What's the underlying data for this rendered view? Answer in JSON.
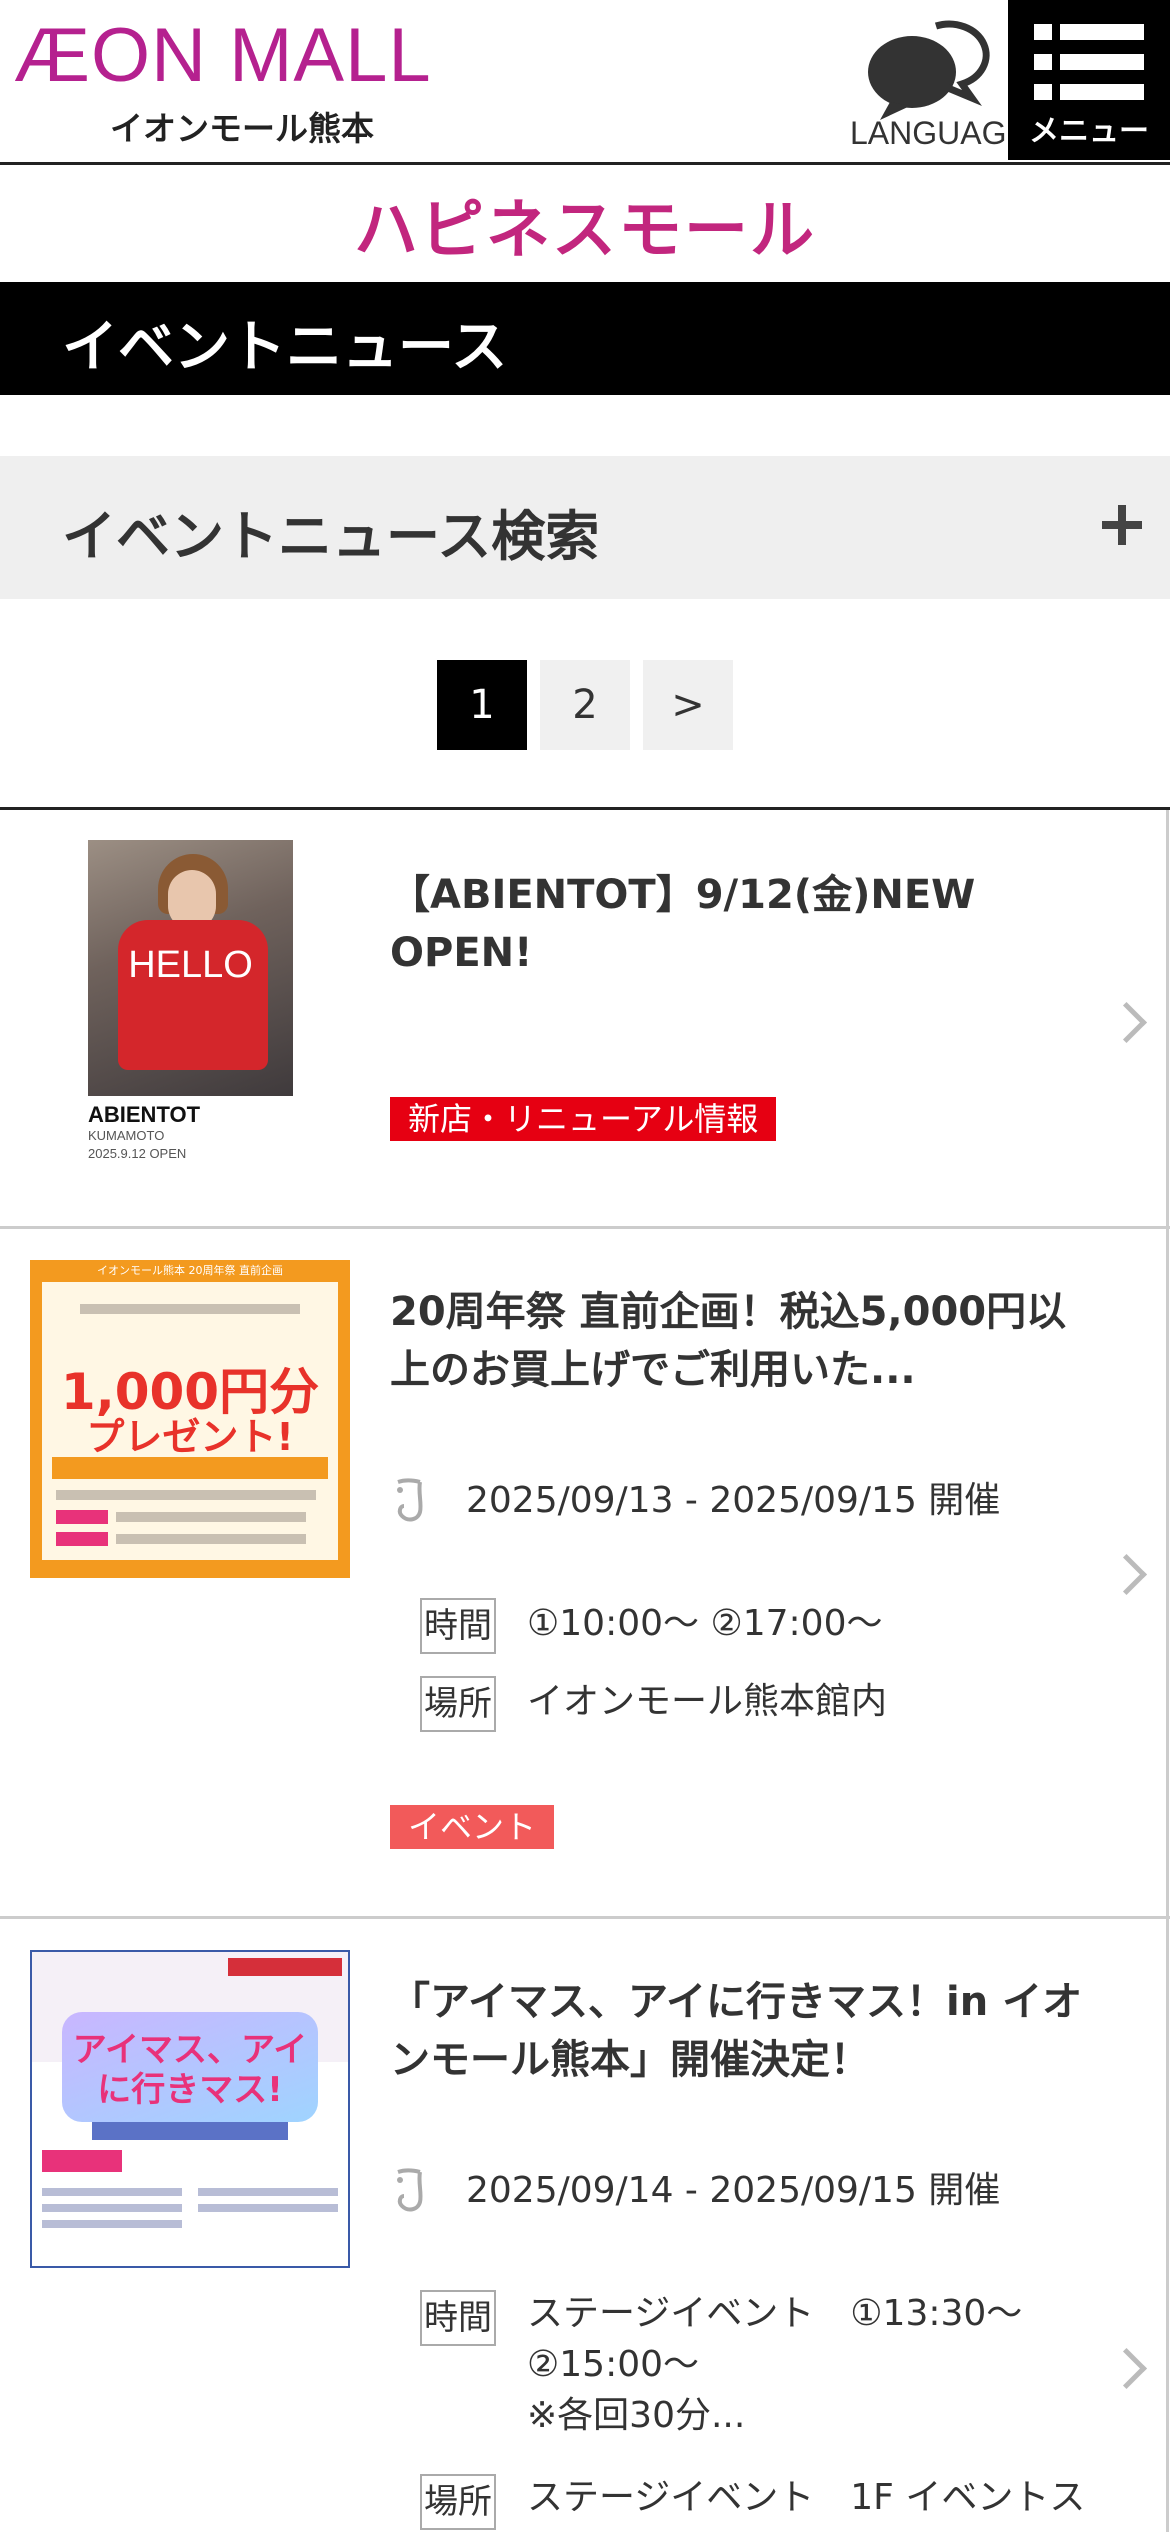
{
  "header": {
    "logo_main": "ÆON MALL",
    "logo_sub": "イオンモール熊本",
    "language_label": "LANGUAGE",
    "menu_label": "メニュー"
  },
  "brand": {
    "text": "ハピネスモール"
  },
  "page_title": "イベントニュース",
  "search": {
    "title": "イベントニュース検索"
  },
  "pagination": {
    "pages": [
      "1",
      "2"
    ],
    "next": ">",
    "current": "1"
  },
  "items": [
    {
      "title": "【ABIENTOT】9/12(金)NEW OPEN!",
      "thumb": {
        "hello": "HELLO",
        "brand": "ABIENTOT",
        "city": "KUMAMOTO",
        "date": "2025.9.12 OPEN"
      },
      "category": "新店・リニューアル情報",
      "category_color": "#e60012"
    },
    {
      "title": "20周年祭 直前企画！税込5,000円以上のお買上げでご利用いた...",
      "thumb": {
        "big": "1,000円分",
        "present": "プレゼント!",
        "header": "イオンモール熊本 20周年祭 直前企画"
      },
      "date": "2025/09/13 - 2025/09/15 開催",
      "time_label": "時間",
      "time_value": "①10:00〜 ②17:00〜",
      "place_label": "場所",
      "place_value": "イオンモール熊本館内",
      "category": "イベント",
      "category_color": "#f25a5a"
    },
    {
      "title": "「アイマス、アイに行きマス！in イオンモール熊本」開催決定！",
      "thumb": {
        "title": "アイマス、アイに行きマス!"
      },
      "date": "2025/09/14 - 2025/09/15 開催",
      "time_label": "時間",
      "time_value_1": "ステージイベント　①13:30〜",
      "time_value_2": "②15:00〜",
      "time_value_3": "※各回30分...",
      "place_label": "場所",
      "place_value": "ステージイベント　1F イベントス"
    }
  ]
}
